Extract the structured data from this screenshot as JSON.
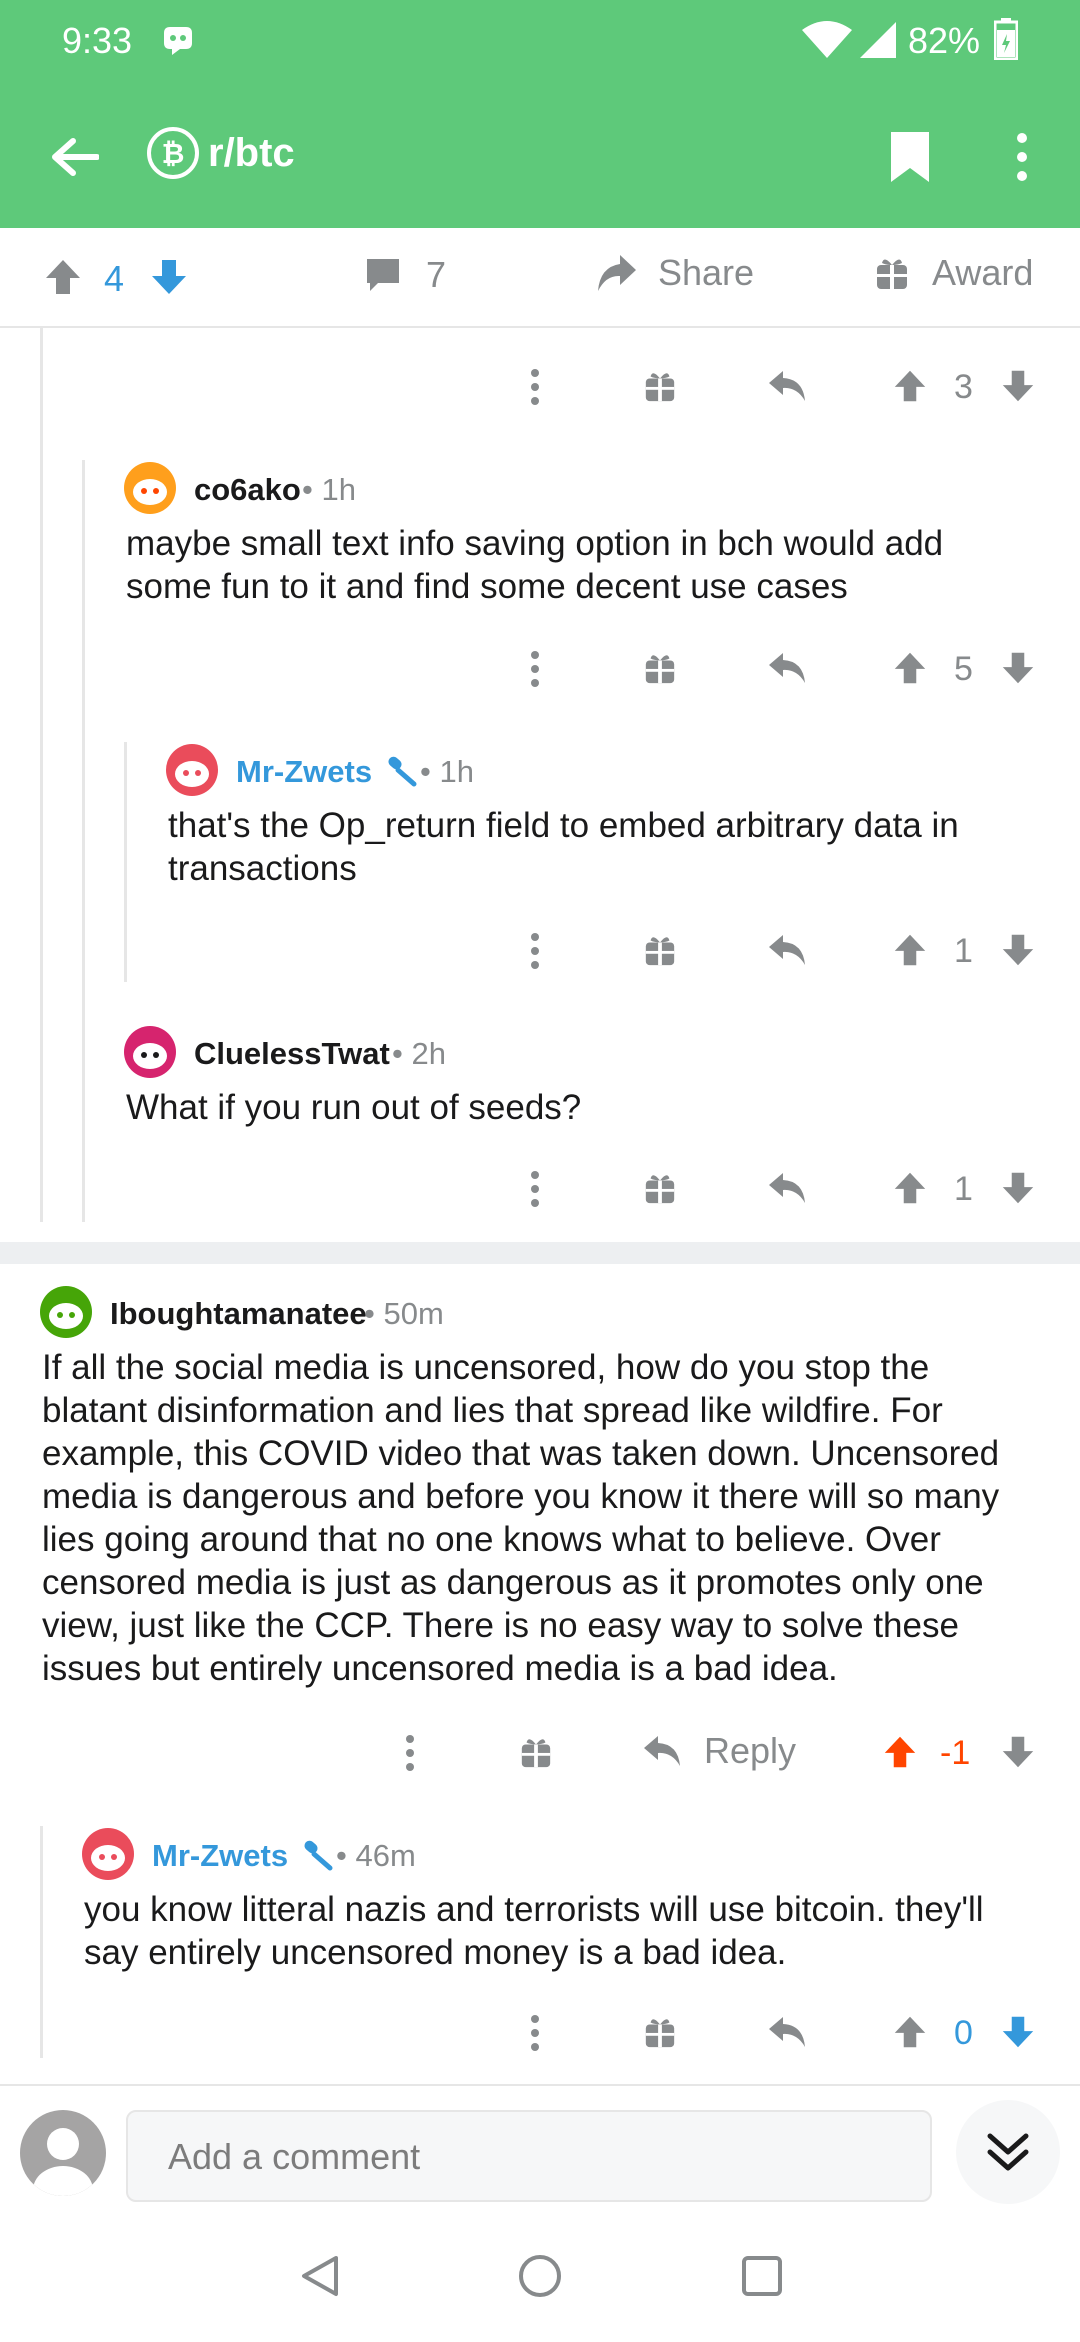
{
  "status": {
    "time": "9:33",
    "battery": "82%"
  },
  "header": {
    "subreddit": "r/btc"
  },
  "post_actions": {
    "score": "4",
    "comments": "7",
    "share": "Share",
    "award": "Award"
  },
  "comments": [
    {
      "score": "3"
    },
    {
      "user": "co6ako",
      "time": "1h",
      "text_lines": [
        "maybe small text info saving option in bch would add",
        "some fun to it and find some decent use cases"
      ],
      "score": "5"
    },
    {
      "user": "Mr-Zwets",
      "time": "1h",
      "text_lines": [
        "that's the Op_return field to embed arbitrary data in",
        "transactions"
      ],
      "score": "1"
    },
    {
      "user": "CluelessTwat",
      "time": "2h",
      "text_lines": [
        "What if you run out of seeds?"
      ],
      "score": "1"
    },
    {
      "user": "Iboughtamanatee",
      "time": "50m",
      "text_lines": [
        "If all the social media is uncensored, how do you stop the",
        "blatant disinformation and lies that spread like wildfire. For",
        "example, this COVID video that was taken down. Uncensored",
        "media is dangerous and before you know it there will so many",
        "lies going around that no one knows what to believe. Over",
        "censored media is just as dangerous as it promotes only one",
        "view, just like the CCP. There is no easy way to solve these",
        "issues but entirely uncensored media is a bad idea."
      ],
      "reply_label": "Reply",
      "score": "-1"
    },
    {
      "user": "Mr-Zwets",
      "time": "46m",
      "text_lines": [
        "you know litteral nazis and terrorists will use bitcoin. they'll",
        "say entirely uncensored money is a bad idea."
      ],
      "score": "0"
    }
  ],
  "composer": {
    "placeholder": "Add a comment"
  },
  "colors": {
    "header_green": "#5ec97a",
    "upvote_orange": "#ff4500",
    "blue": "#3498db",
    "gray": "#878a8c"
  }
}
